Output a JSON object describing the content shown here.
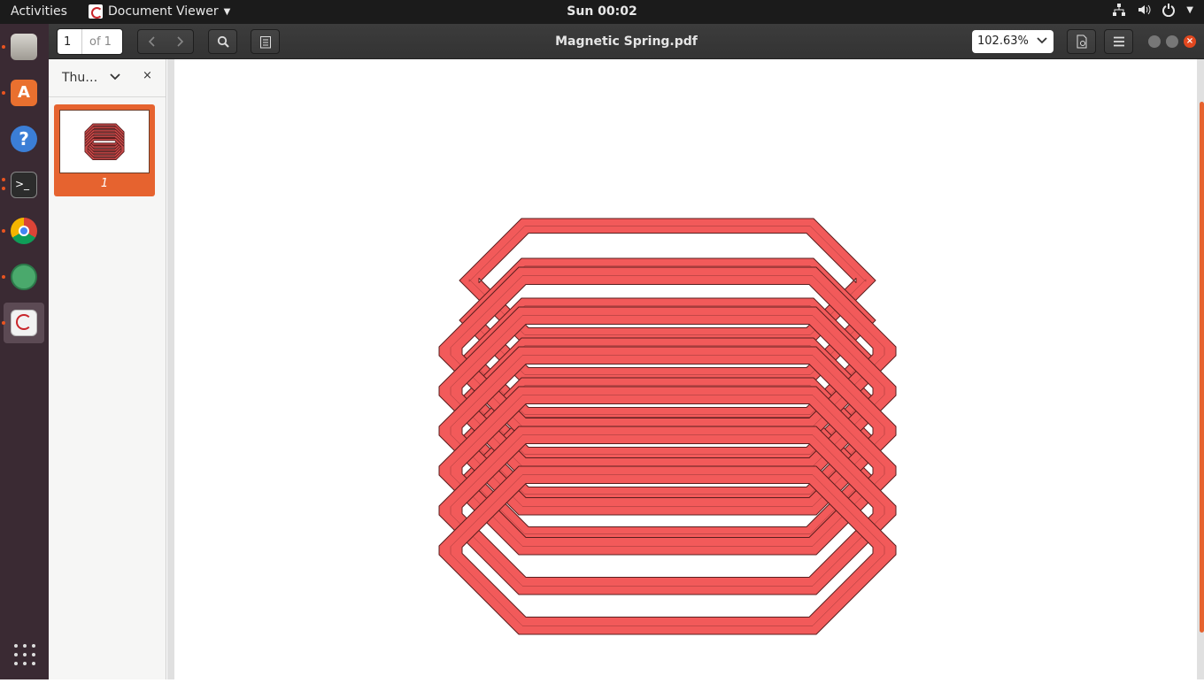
{
  "topbar": {
    "activities": "Activities",
    "app_name": "Document Viewer",
    "clock": "Sun 00:02"
  },
  "dock": {
    "items": [
      {
        "name": "files",
        "running": true
      },
      {
        "name": "software-center",
        "running": true
      },
      {
        "name": "help",
        "running": false
      },
      {
        "name": "terminal",
        "running": true
      },
      {
        "name": "chrome",
        "running": true
      },
      {
        "name": "atom",
        "running": true
      },
      {
        "name": "document-viewer",
        "running": true,
        "active": true
      }
    ]
  },
  "headerbar": {
    "page_number": "1",
    "page_total": "of 1",
    "title": "Magnetic Spring.pdf",
    "zoom": "102.63%"
  },
  "sidebar": {
    "mode_label": "Thu…",
    "close_glyph": "×",
    "thumbnails": [
      {
        "label": "1"
      }
    ]
  },
  "colors": {
    "accent": "#e6632f",
    "spring_fill": "#f25a5a",
    "spring_edge": "#5a1e1e"
  }
}
